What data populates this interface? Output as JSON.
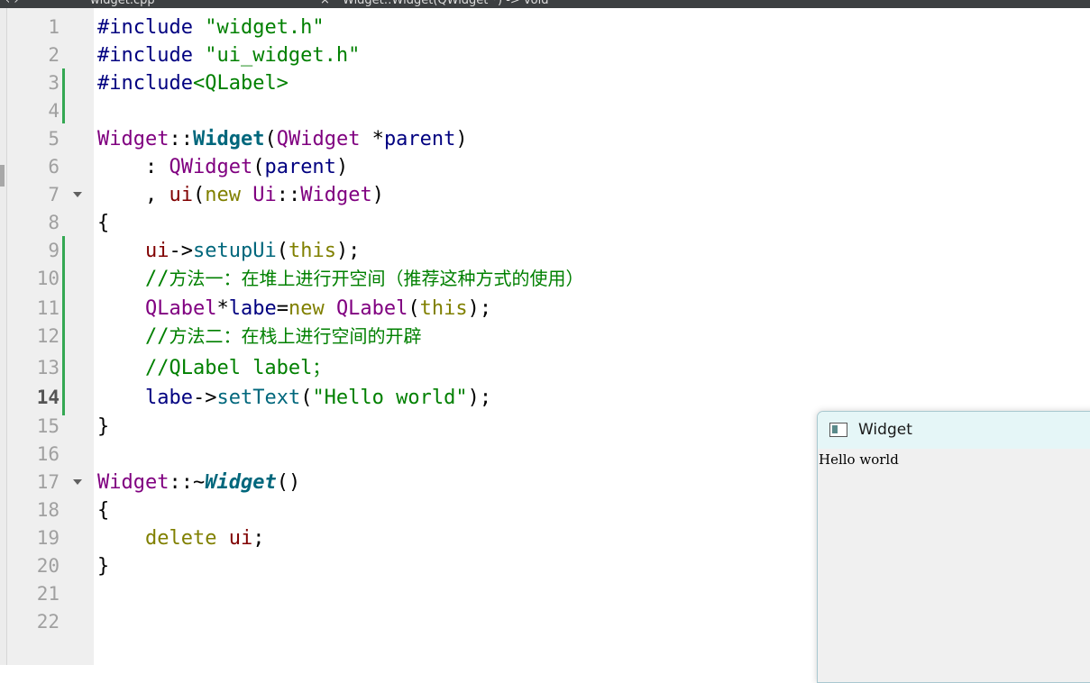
{
  "editor": {
    "file_tab": "widget.cpp",
    "breadcrumb": "Widget::Widget(QWidget *) -> void",
    "lines": [
      {
        "n": "1",
        "tokens": [
          {
            "c": "t-pre",
            "t": "#include "
          },
          {
            "c": "t-str",
            "t": "\"widget.h\""
          }
        ]
      },
      {
        "n": "2",
        "tokens": [
          {
            "c": "t-pre",
            "t": "#include "
          },
          {
            "c": "t-str",
            "t": "\"ui_widget.h\""
          }
        ]
      },
      {
        "n": "3",
        "tokens": [
          {
            "c": "t-pre",
            "t": "#include"
          },
          {
            "c": "t-str",
            "t": "<QLabel>"
          }
        ]
      },
      {
        "n": "4",
        "tokens": []
      },
      {
        "n": "5",
        "tokens": [
          {
            "c": "t-type",
            "t": "Widget"
          },
          {
            "c": "t-op",
            "t": "::"
          },
          {
            "c": "t-func",
            "t": "Widget"
          },
          {
            "c": "t-op",
            "t": "("
          },
          {
            "c": "t-type",
            "t": "QWidget"
          },
          {
            "c": "t-op",
            "t": " *"
          },
          {
            "c": "t-id",
            "t": "parent"
          },
          {
            "c": "t-op",
            "t": ")"
          }
        ]
      },
      {
        "n": "6",
        "tokens": [
          {
            "c": "t-op",
            "t": "    : "
          },
          {
            "c": "t-type",
            "t": "QWidget"
          },
          {
            "c": "t-op",
            "t": "("
          },
          {
            "c": "t-id",
            "t": "parent"
          },
          {
            "c": "t-op",
            "t": ")"
          }
        ]
      },
      {
        "n": "7",
        "fold": true,
        "tokens": [
          {
            "c": "t-op",
            "t": "    , "
          },
          {
            "c": "t-var",
            "t": "ui"
          },
          {
            "c": "t-op",
            "t": "("
          },
          {
            "c": "t-kw",
            "t": "new "
          },
          {
            "c": "t-type",
            "t": "Ui"
          },
          {
            "c": "t-op",
            "t": "::"
          },
          {
            "c": "t-type",
            "t": "Widget"
          },
          {
            "c": "t-op",
            "t": ")"
          }
        ]
      },
      {
        "n": "8",
        "tokens": [
          {
            "c": "t-op",
            "t": "{"
          }
        ]
      },
      {
        "n": "9",
        "tokens": [
          {
            "c": "t-op",
            "t": "    "
          },
          {
            "c": "t-var",
            "t": "ui"
          },
          {
            "c": "t-op",
            "t": "->"
          },
          {
            "c": "t-call",
            "t": "setupUi"
          },
          {
            "c": "t-op",
            "t": "("
          },
          {
            "c": "t-kw",
            "t": "this"
          },
          {
            "c": "t-op",
            "t": ");"
          }
        ]
      },
      {
        "n": "10",
        "tokens": [
          {
            "c": "t-op",
            "t": "    "
          },
          {
            "c": "t-cmt",
            "t": "//"
          },
          {
            "c": "t-cmt cmt-cjk",
            "t": "方法一：在堆上进行开空间（推荐这种方式的使用）"
          }
        ]
      },
      {
        "n": "11",
        "tokens": [
          {
            "c": "t-op",
            "t": "    "
          },
          {
            "c": "t-type",
            "t": "QLabel"
          },
          {
            "c": "t-op",
            "t": "*"
          },
          {
            "c": "t-id",
            "t": "labe"
          },
          {
            "c": "t-op",
            "t": "="
          },
          {
            "c": "t-kw",
            "t": "new "
          },
          {
            "c": "t-type",
            "t": "QLabel"
          },
          {
            "c": "t-op",
            "t": "("
          },
          {
            "c": "t-kw",
            "t": "this"
          },
          {
            "c": "t-op",
            "t": ");"
          }
        ]
      },
      {
        "n": "12",
        "tokens": [
          {
            "c": "t-op",
            "t": "    "
          },
          {
            "c": "t-cmt",
            "t": "//"
          },
          {
            "c": "t-cmt cmt-cjk",
            "t": "方法二：在栈上进行空间的开辟"
          }
        ]
      },
      {
        "n": "13",
        "tokens": [
          {
            "c": "t-op",
            "t": "    "
          },
          {
            "c": "t-cmt",
            "t": "//QLabel label"
          },
          {
            "c": "t-cmt cmt-cjk",
            "t": "；"
          }
        ]
      },
      {
        "n": "14",
        "current": true,
        "tokens": [
          {
            "c": "t-op",
            "t": "    "
          },
          {
            "c": "t-id",
            "t": "labe"
          },
          {
            "c": "t-op",
            "t": "->"
          },
          {
            "c": "t-call",
            "t": "setText"
          },
          {
            "c": "t-op",
            "t": "("
          },
          {
            "c": "t-str",
            "t": "\"Hello world\""
          },
          {
            "c": "t-op",
            "t": ");"
          }
        ]
      },
      {
        "n": "15",
        "tokens": [
          {
            "c": "t-op",
            "t": "}"
          }
        ]
      },
      {
        "n": "16",
        "tokens": []
      },
      {
        "n": "17",
        "fold": true,
        "tokens": [
          {
            "c": "t-type",
            "t": "Widget"
          },
          {
            "c": "t-op",
            "t": "::~"
          },
          {
            "c": "t-func-i",
            "t": "Widget"
          },
          {
            "c": "t-op",
            "t": "()"
          }
        ]
      },
      {
        "n": "18",
        "tokens": [
          {
            "c": "t-op",
            "t": "{"
          }
        ]
      },
      {
        "n": "19",
        "tokens": [
          {
            "c": "t-op",
            "t": "    "
          },
          {
            "c": "t-kw",
            "t": "delete "
          },
          {
            "c": "t-var",
            "t": "ui"
          },
          {
            "c": "t-op",
            "t": ";"
          }
        ]
      },
      {
        "n": "20",
        "tokens": [
          {
            "c": "t-op",
            "t": "}"
          }
        ]
      },
      {
        "n": "21",
        "tokens": []
      },
      {
        "n": "22",
        "tokens": []
      }
    ]
  },
  "preview_window": {
    "title": "Widget",
    "icon": "qt-window-icon",
    "label_text": "Hello world"
  },
  "colors": {
    "modified_marker": "#34a853",
    "preview_titlebar": "#e5f6f7"
  }
}
